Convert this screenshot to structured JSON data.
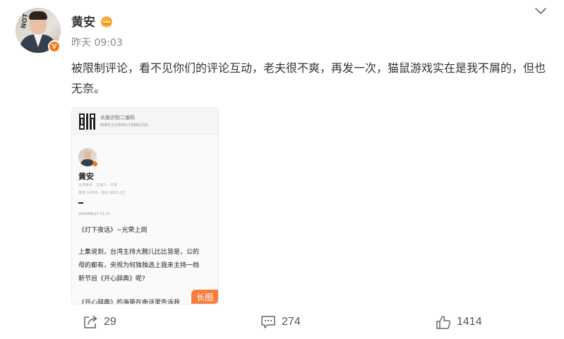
{
  "post": {
    "username": "黄安",
    "time": "昨天 09:03",
    "verified_badge": "V",
    "text": "被限制评论，看不见你们的评论互动，老夫很不爽，再发一次，猫鼠游戏实在是我不屑的，但也无奈。"
  },
  "card": {
    "qr_title": "长按识别二维码",
    "qr_subtitle": "微博长文还有8617条精彩内容",
    "author_name": "黄安",
    "author_meta1": "台湾歌手、主持人、作家",
    "author_meta2": "微博 10080 · 粉丝 8891.6万",
    "date": "2024/06/17 21:17",
    "title": "《灯下夜话》~光荣上岗",
    "body_lines": [
      "上集说到，台湾主持大腕儿比比皆是，公的",
      "母的都有，央视为何独独选上我来主持一档",
      "新节目《开心辞典》呢?"
    ],
    "cut_line": "《开心辞典》的海量在电话里告诉我",
    "long_image_label": "长图"
  },
  "actions": {
    "share_count": "29",
    "comment_count": "274",
    "like_count": "1414"
  },
  "colors": {
    "accent_orange": "#fa7d3c",
    "badge_orange": "#f27a1a",
    "text": "#333333",
    "muted": "#8a8a8a"
  },
  "icons": [
    "chevron-down-icon",
    "crown-icon",
    "share-icon",
    "comment-icon",
    "like-icon",
    "qr-code-icon",
    "verified-badge-icon"
  ]
}
